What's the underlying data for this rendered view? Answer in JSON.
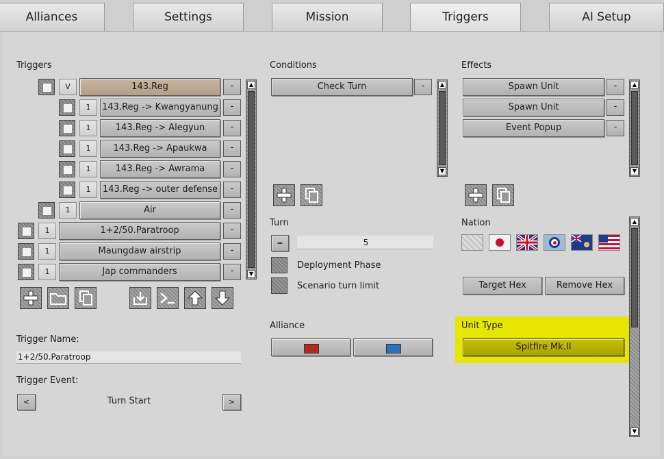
{
  "tabs": [
    {
      "label": "Alliances"
    },
    {
      "label": "Settings"
    },
    {
      "label": "Mission"
    },
    {
      "label": "Triggers"
    },
    {
      "label": "AI Setup"
    }
  ],
  "triggers": {
    "heading": "Triggers",
    "rows": [
      {
        "count": "V",
        "label": "143.Reg"
      },
      {
        "count": "1",
        "label": "143.Reg -> Kwangyanung"
      },
      {
        "count": "1",
        "label": "143.Reg -> Alegyun"
      },
      {
        "count": "1",
        "label": "143.Reg -> Apaukwa"
      },
      {
        "count": "1",
        "label": "143.Reg -> Awrama"
      },
      {
        "count": "1",
        "label": "143.Reg -> outer defense"
      },
      {
        "count": "1",
        "label": "Air"
      },
      {
        "count": "1",
        "label": "1+2/50.Paratroop"
      },
      {
        "count": "1",
        "label": "Maungdaw airstrip"
      },
      {
        "count": "1",
        "label": "Jap commanders"
      }
    ],
    "minus": "-",
    "name_label": "Trigger Name:",
    "name_value": "1+2/50.Paratroop",
    "event_label": "Trigger Event:",
    "event_value": "Turn Start",
    "event_prev": "<",
    "event_next": ">"
  },
  "conditions": {
    "heading": "Conditions",
    "items": [
      "Check Turn"
    ],
    "turn_label": "Turn",
    "turn_operator": "=",
    "turn_value": "5",
    "deployment_label": "Deployment Phase",
    "turn_limit_label": "Scenario turn limit",
    "alliance_label": "Alliance",
    "alliance_colors": [
      "#b0281e",
      "#2e6fc0"
    ]
  },
  "effects": {
    "heading": "Effects",
    "items": [
      "Spawn Unit",
      "Spawn Unit",
      "Event Popup"
    ],
    "nation_label": "Nation",
    "target_hex": "Target Hex",
    "remove_hex": "Remove Hex",
    "unit_type_label": "Unit Type",
    "unit_type_value": "Spitfire Mk.II",
    "highlight_color": "#e6e600"
  },
  "icons": {
    "add": "plus-icon",
    "folder": "folder-icon",
    "copy": "copy-icon",
    "import": "import-icon",
    "console": "console-icon",
    "up": "arrow-up-icon",
    "down": "arrow-down-icon"
  }
}
